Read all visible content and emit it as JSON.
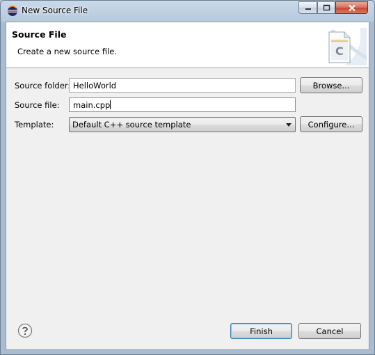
{
  "window": {
    "title": "New Source File",
    "app_icon": "eclipse-icon",
    "controls": [
      "minimize",
      "maximize",
      "close"
    ]
  },
  "header": {
    "title": "Source File",
    "description": "Create a new source file.",
    "art_icon": "c-source-file-icon",
    "art_letter": "C"
  },
  "form": {
    "source_folder": {
      "label": "Source folder:",
      "value": "HelloWorld",
      "button": "Browse..."
    },
    "source_file": {
      "label": "Source file:",
      "value": "main.cpp"
    },
    "template": {
      "label": "Template:",
      "selected": "Default C++ source template",
      "button": "Configure..."
    }
  },
  "footer": {
    "help_icon": "help-icon",
    "finish": "Finish",
    "cancel": "Cancel"
  },
  "colors": {
    "window_frame": "#a9bdd2",
    "client_bg": "#f0f0f0",
    "focus_border": "#569de5",
    "close_button": "#c7452f"
  }
}
